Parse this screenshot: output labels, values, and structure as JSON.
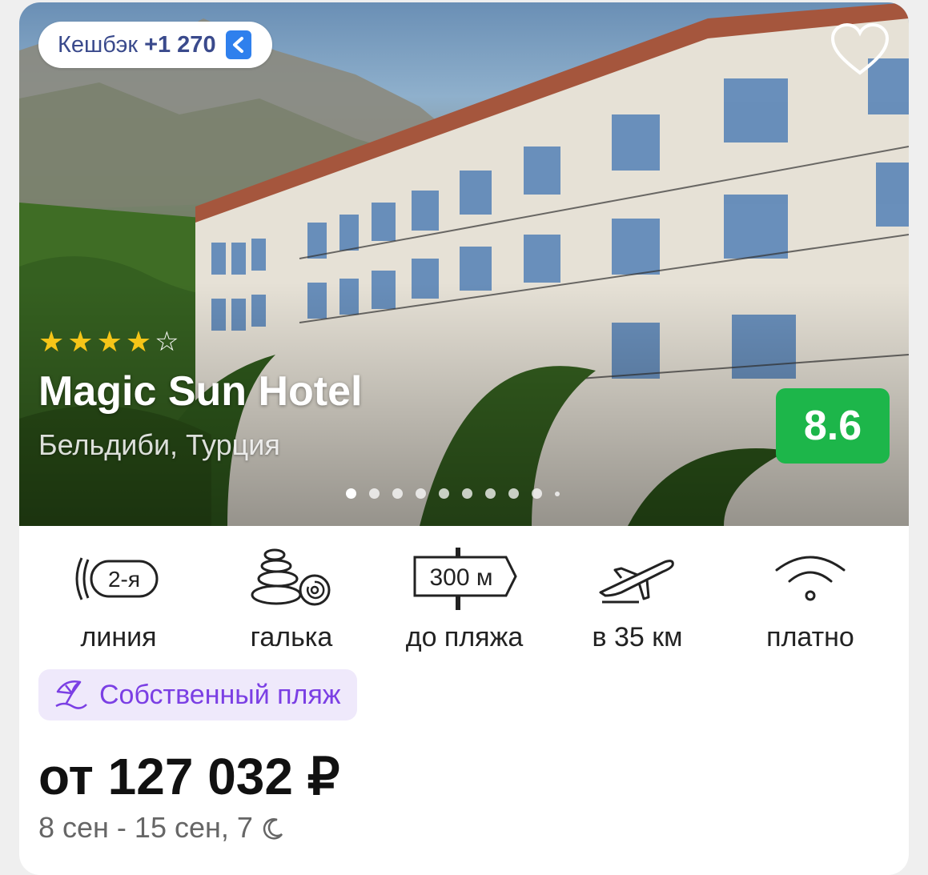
{
  "cashback": {
    "label": "Кешбэк",
    "amount": "+1 270"
  },
  "hotel": {
    "stars": 4,
    "max_stars": 5,
    "name": "Magic Sun Hotel",
    "location": "Бельдиби, Турция",
    "rating": "8.6"
  },
  "carousel": {
    "total_dots": 10,
    "active_index": 0
  },
  "features": [
    {
      "icon": "line-badge-icon",
      "icon_text": "2-я",
      "label": "линия"
    },
    {
      "icon": "pebbles-icon",
      "label": "галька"
    },
    {
      "icon": "signpost-icon",
      "icon_text": "300 м",
      "label": "до пляжа"
    },
    {
      "icon": "airplane-icon",
      "label": "в 35 км"
    },
    {
      "icon": "wifi-icon",
      "label": "платно"
    }
  ],
  "badge": {
    "label": "Собственный пляж",
    "icon": "beach-umbrella-icon"
  },
  "price": {
    "text": "от 127 032 ₽"
  },
  "dates": {
    "text": "8 сен - 15 сен, 7"
  },
  "colors": {
    "rating_bg": "#1db64a",
    "badge_text": "#7b3fe4",
    "badge_bg": "#efe9fb",
    "cashback_text": "#3a4a8c",
    "star": "#f5c518"
  }
}
